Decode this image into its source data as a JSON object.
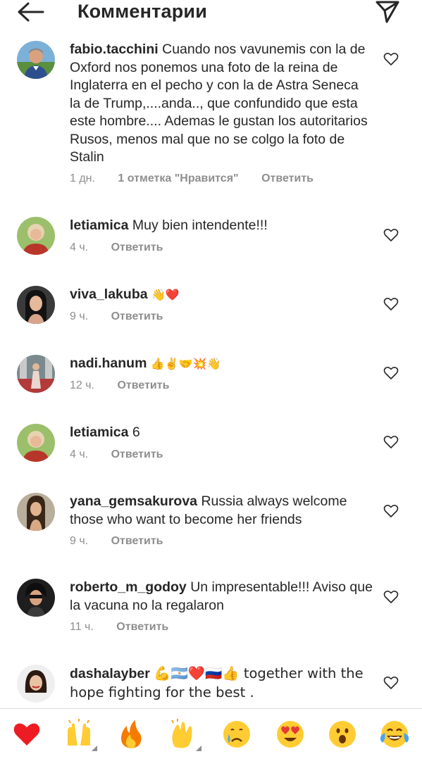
{
  "header": {
    "title": "Комментарии"
  },
  "comments": [
    {
      "username": "fabio.tacchini",
      "text": "Cuando nos vavunemis con la de Oxford nos ponemos una foto de la reina de Inglaterra en el pecho y con la de Astra Seneca la de Trump,....anda.., que confundido que esta este hombre.... Ademas le gustan los autoritarios Rusos, menos mal que no se colgo la foto de Stalin",
      "time": "1 дн.",
      "likes": "1 отметка \"Нравится\"",
      "reply": "Ответить"
    },
    {
      "username": "letiamica",
      "text": "Muy bien intendente!!!",
      "time": "4 ч.",
      "reply": "Ответить"
    },
    {
      "username": "viva_lakuba",
      "text": "👋❤️",
      "time": "9 ч.",
      "reply": "Ответить"
    },
    {
      "username": "nadi.hanum",
      "text": "👍✌️🤝💥👋",
      "time": "12 ч.",
      "reply": "Ответить"
    },
    {
      "username": "letiamica",
      "text": "6",
      "time": "4 ч.",
      "reply": "Ответить"
    },
    {
      "username": "yana_gemsakurova",
      "text": "Russia always welcome those who want to become her friends",
      "time": "9 ч.",
      "reply": "Ответить"
    },
    {
      "username": "roberto_m_godoy",
      "text": "Un impresentable!!! Aviso que la vacuna no la regalaron",
      "time": "11 ч.",
      "reply": "Ответить"
    },
    {
      "username": "dashalayber",
      "text": "💪🇦🇷❤️🇷🇺👍 together with the hope fighting for the best .",
      "time": "",
      "reply": ""
    }
  ],
  "reactions": [
    "heart",
    "raised-hands",
    "fire",
    "clapping-hands",
    "crying-face",
    "heart-eyes-face",
    "surprised-face",
    "tears-of-joy-face"
  ],
  "colors": {
    "text": "#262626",
    "secondary": "#8e8e8e",
    "heart_red": "#ed1c24",
    "emoji_yellow": "#ffcc33"
  }
}
